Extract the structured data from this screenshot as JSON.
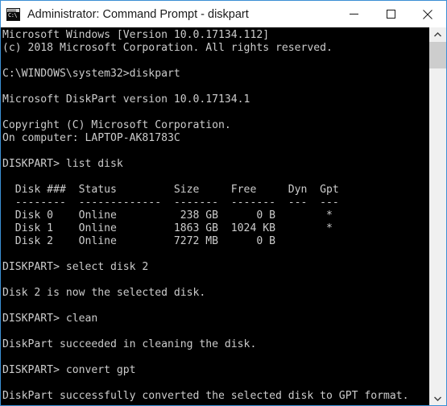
{
  "window": {
    "title": "Administrator: Command Prompt - diskpart",
    "app_icon": "command-prompt-icon",
    "icon_glyph": "C:\\",
    "border_color": "#3b8fd4",
    "titlebar_bg": "#ffffff",
    "console_bg": "#000000",
    "console_fg": "#cccccc"
  },
  "window_controls": {
    "minimize_label": "Minimize",
    "maximize_label": "Maximize",
    "close_label": "Close"
  },
  "scrollbar": {
    "up_arrow_label": "Scroll up",
    "down_arrow_label": "Scroll down",
    "thumb_label": "Scroll thumb",
    "thumb_color": "#cdcdcd",
    "track_color": "#f0f0f0"
  },
  "console": {
    "lines": [
      "Microsoft Windows [Version 10.0.17134.112]",
      "(c) 2018 Microsoft Corporation. All rights reserved.",
      "",
      "C:\\WINDOWS\\system32>diskpart",
      "",
      "Microsoft DiskPart version 10.0.17134.1",
      "",
      "Copyright (C) Microsoft Corporation.",
      "On computer: LAPTOP-AK81783C",
      "",
      "DISKPART> list disk",
      "",
      "  Disk ###  Status         Size     Free     Dyn  Gpt",
      "  --------  -------------  -------  -------  ---  ---",
      "  Disk 0    Online          238 GB      0 B        *",
      "  Disk 1    Online         1863 GB  1024 KB        *",
      "  Disk 2    Online         7272 MB      0 B",
      "",
      "DISKPART> select disk 2",
      "",
      "Disk 2 is now the selected disk.",
      "",
      "DISKPART> clean",
      "",
      "DiskPart succeeded in cleaning the disk.",
      "",
      "DISKPART> convert gpt",
      "",
      "DiskPart successfully converted the selected disk to GPT format."
    ],
    "os_version": "10.0.17134.112",
    "copyright_year": "2018",
    "working_directory": "C:\\WINDOWS\\system32",
    "diskpart_version": "10.0.17134.1",
    "computer_name": "LAPTOP-AK81783C",
    "prompt": "DISKPART>",
    "commands": [
      "diskpart",
      "list disk",
      "select disk 2",
      "clean",
      "convert gpt"
    ],
    "disk_table": {
      "headers": [
        "Disk ###",
        "Status",
        "Size",
        "Free",
        "Dyn",
        "Gpt"
      ],
      "rows": [
        [
          "Disk 0",
          "Online",
          "238 GB",
          "0 B",
          "",
          "*"
        ],
        [
          "Disk 1",
          "Online",
          "1863 GB",
          "1024 KB",
          "",
          "*"
        ],
        [
          "Disk 2",
          "Online",
          "7272 MB",
          "0 B",
          "",
          ""
        ]
      ]
    },
    "messages": [
      "Disk 2 is now the selected disk.",
      "DiskPart succeeded in cleaning the disk.",
      "DiskPart successfully converted the selected disk to GPT format."
    ]
  }
}
